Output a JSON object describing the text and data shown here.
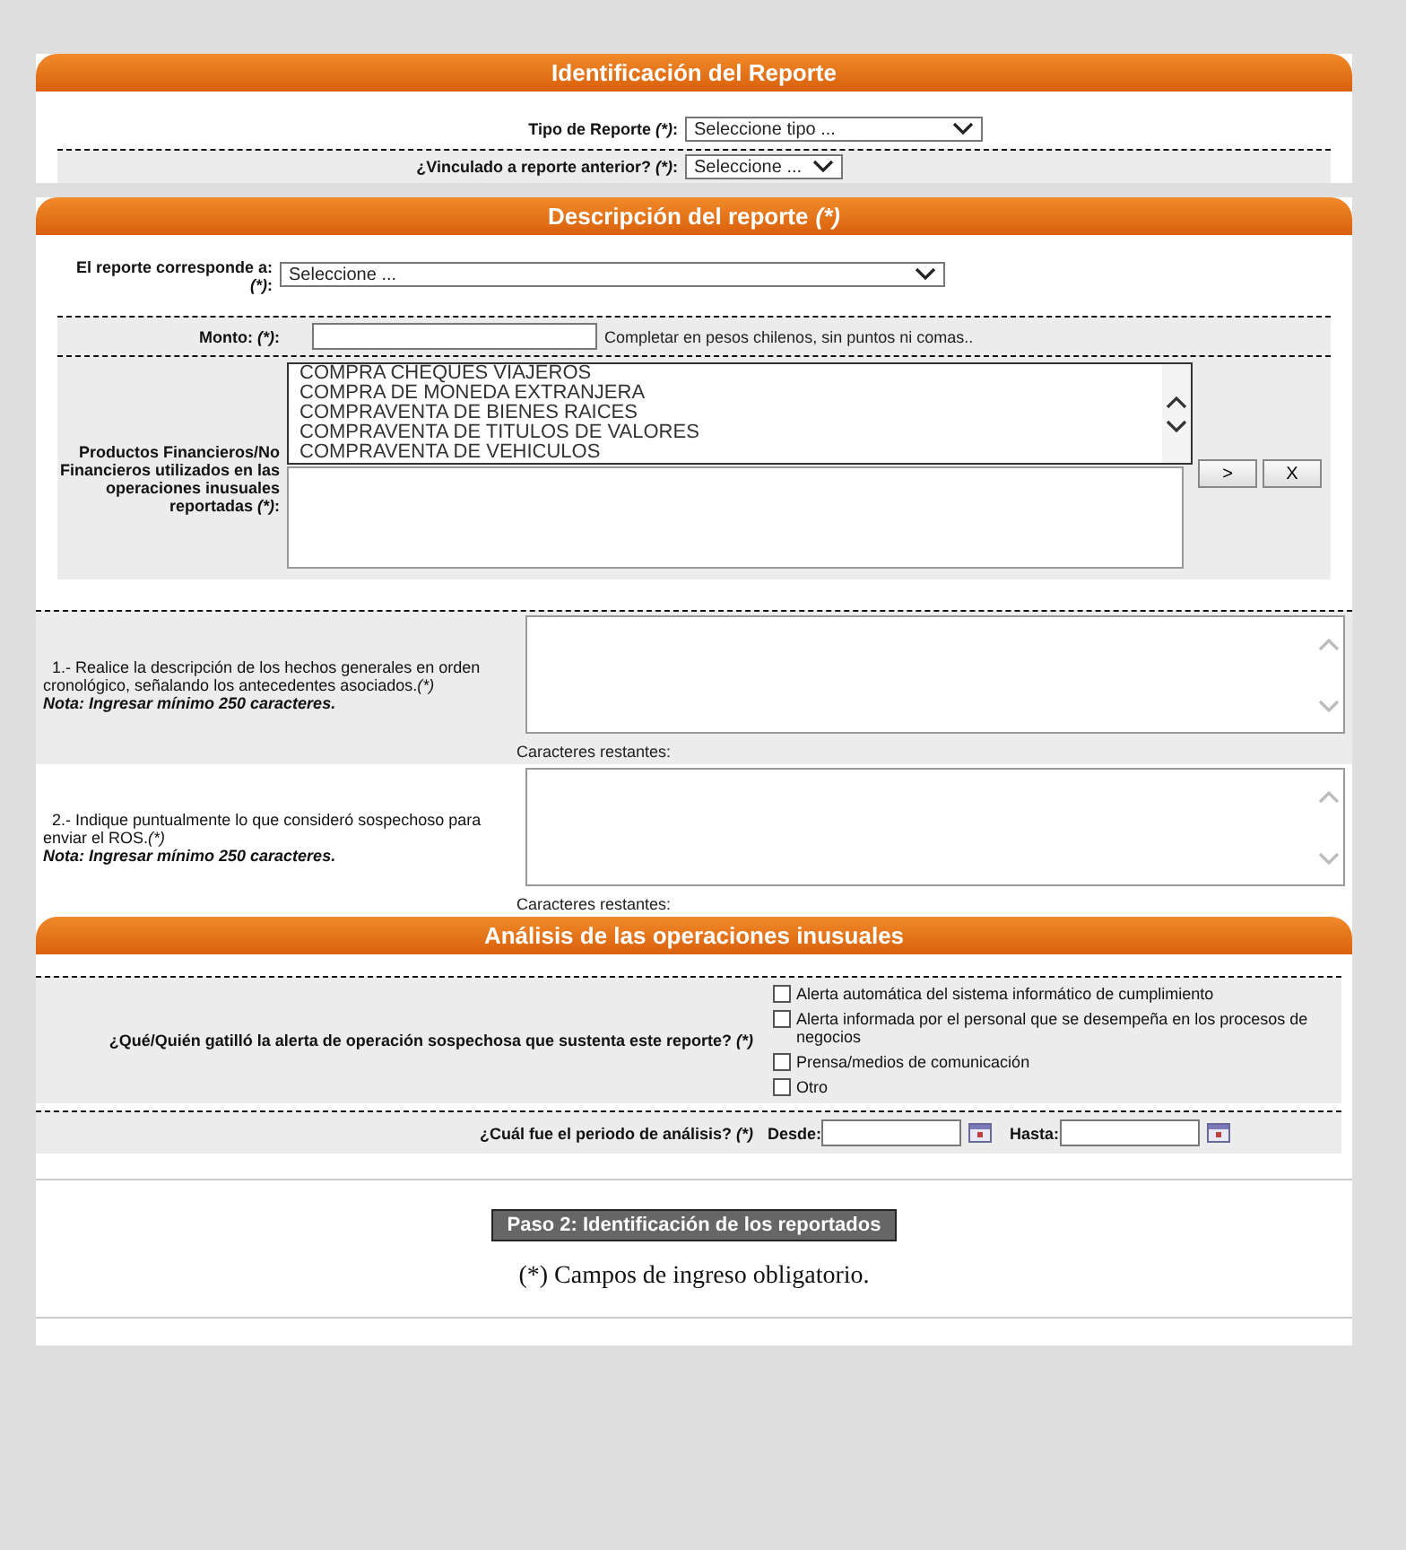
{
  "identificacion": {
    "title": "Identificación del Reporte",
    "tipo": {
      "label": "Tipo de Reporte ",
      "mark": "(*)",
      "suffix": ":",
      "value": "Seleccione tipo ..."
    },
    "vinculado": {
      "label": "¿Vinculado a reporte anterior? ",
      "mark": "(*)",
      "suffix": ":",
      "value": "Seleccione ..."
    }
  },
  "descripcion": {
    "title": "Descripción del reporte ",
    "title_mark": "(*)",
    "corresponde": {
      "label": "El reporte corresponde a: ",
      "mark": "(*)",
      "suffix": ":",
      "value": "Seleccione ..."
    },
    "monto": {
      "label": "Monto: ",
      "mark": "(*)",
      "suffix": ":",
      "hint": "Completar en pesos chilenos, sin puntos ni comas.."
    },
    "productos": {
      "label": "Productos Financieros/No Financieros utilizados en las operaciones inusuales reportadas ",
      "mark": "(*)",
      "suffix": ":",
      "options": [
        "COMPRA CHEQUES VIAJEROS",
        "COMPRA DE MONEDA EXTRANJERA",
        "COMPRAVENTA DE BIENES RAICES",
        "COMPRAVENTA DE TITULOS DE VALORES",
        "COMPRAVENTA DE VEHICULOS"
      ],
      "add_button": ">",
      "remove_button": "X"
    },
    "questions": [
      {
        "text": "1.- Realice la descripción de los hechos generales en orden cronológico, señalando los antecedentes asociados.",
        "mark": "(*)",
        "note": "Nota: Ingresar mínimo 250 caracteres.",
        "counter": "Caracteres restantes:"
      },
      {
        "text": "2.- Indique puntualmente lo que consideró sospechoso para enviar el ROS.",
        "mark": "(*)",
        "note": "Nota: Ingresar mínimo 250 caracteres.",
        "counter": "Caracteres restantes:"
      }
    ]
  },
  "analisis": {
    "title": "Análisis de las operaciones inusuales",
    "alerta": {
      "label": "¿Qué/Quién gatilló la alerta de operación sospechosa que sustenta este reporte? ",
      "mark": "(*)",
      "options": [
        {
          "label": "Alerta automática del sistema informático de cumplimiento",
          "checked": false
        },
        {
          "label": "Alerta informada por el personal que se desempeña en los procesos de negocios",
          "checked": false
        },
        {
          "label": "Prensa/medios de comunicación",
          "checked": false
        },
        {
          "label": "Otro",
          "checked": false
        }
      ]
    },
    "periodo": {
      "label": "¿Cuál fue el periodo de análisis? ",
      "mark": "(*)",
      "desde": "Desde:",
      "hasta": "Hasta:"
    }
  },
  "footer": {
    "button": "Paso 2: Identificación de los reportados",
    "note": "(*) Campos de ingreso obligatorio."
  }
}
